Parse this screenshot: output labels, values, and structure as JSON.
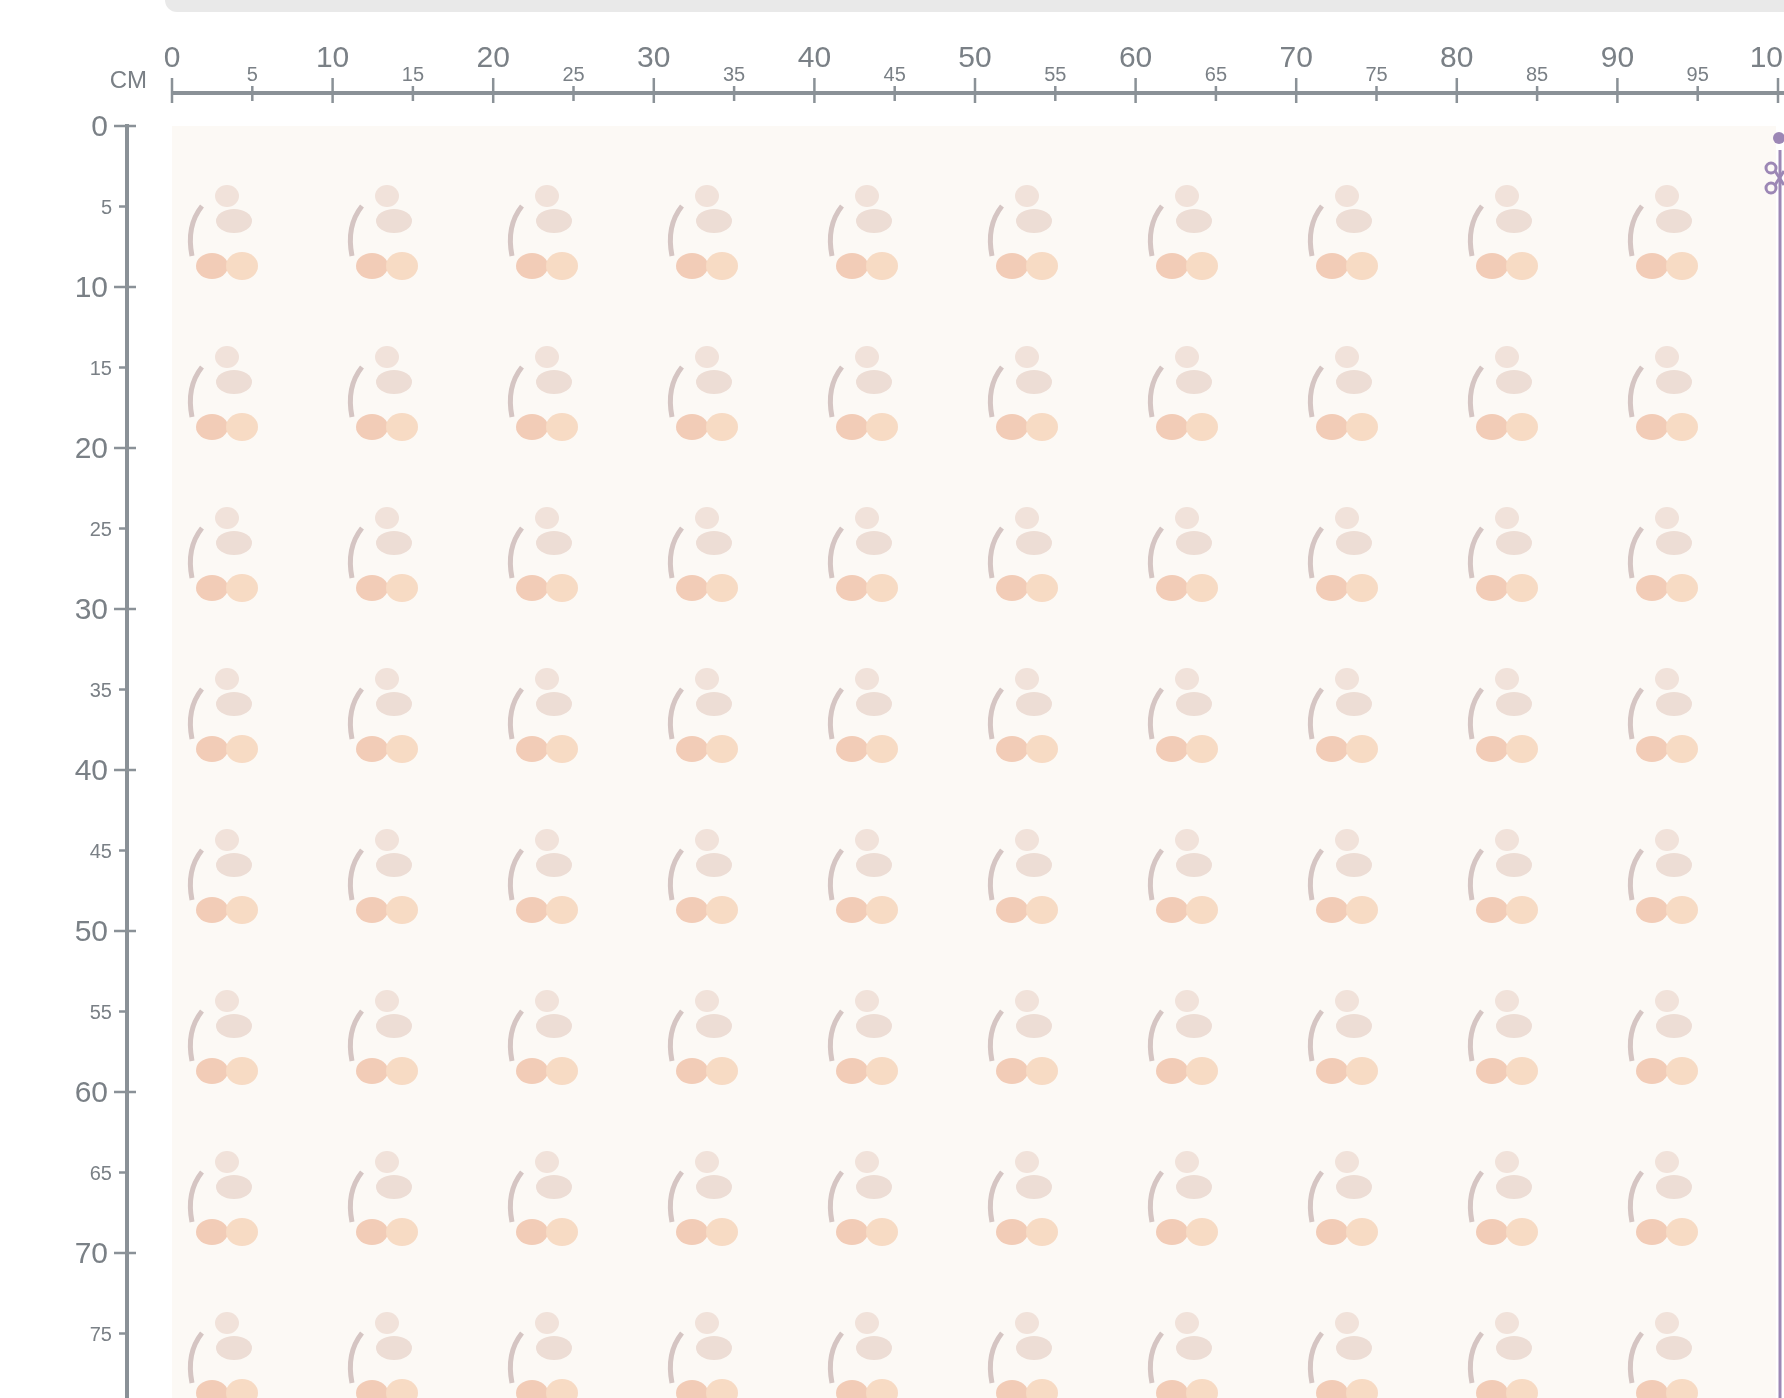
{
  "ruler_unit": "CM",
  "horizontal_ruler": {
    "labels": [
      "0",
      "5",
      "10",
      "15",
      "20",
      "25",
      "30",
      "35",
      "40",
      "45",
      "50",
      "55",
      "60",
      "65",
      "70",
      "75",
      "80",
      "85",
      "90",
      "95",
      "10"
    ]
  },
  "vertical_ruler": {
    "labels": [
      "0",
      "5",
      "10",
      "15",
      "20",
      "25",
      "30",
      "35",
      "40",
      "45",
      "50",
      "55",
      "60",
      "65",
      "70",
      "75"
    ]
  }
}
